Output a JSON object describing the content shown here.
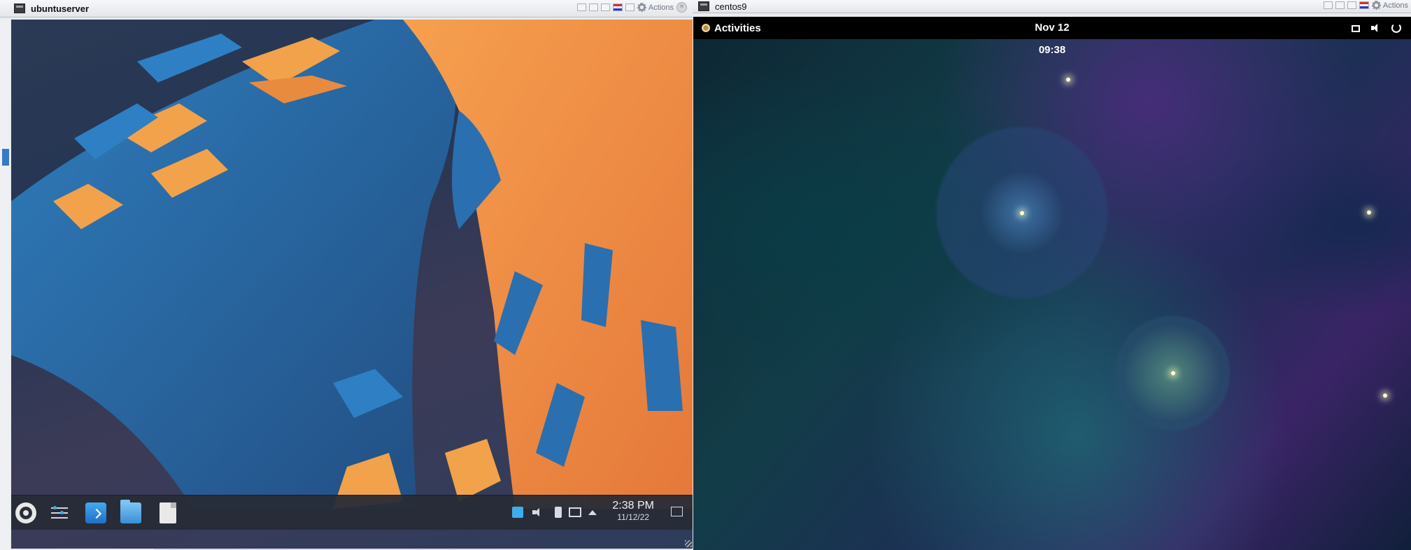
{
  "left_window": {
    "title": "ubuntuserver",
    "actions_label": "Actions",
    "taskbar": {
      "apps": [
        "application-launcher-icon",
        "system-settings-icon",
        "discover-icon",
        "dolphin-file-manager-icon",
        "text-editor-icon"
      ],
      "clock_time": "2:38 PM",
      "clock_date": "11/12/22"
    }
  },
  "right_window": {
    "title": "centos9",
    "actions_label": "Actions",
    "topbar": {
      "activities_label": "Activities",
      "datetime": "Nov 12  09:38"
    }
  },
  "colors": {
    "kde_panel": "#262c36",
    "gnome_topbar": "#000000",
    "kde_orange": "#f08c3c",
    "kde_blue": "#2f7fc4"
  }
}
